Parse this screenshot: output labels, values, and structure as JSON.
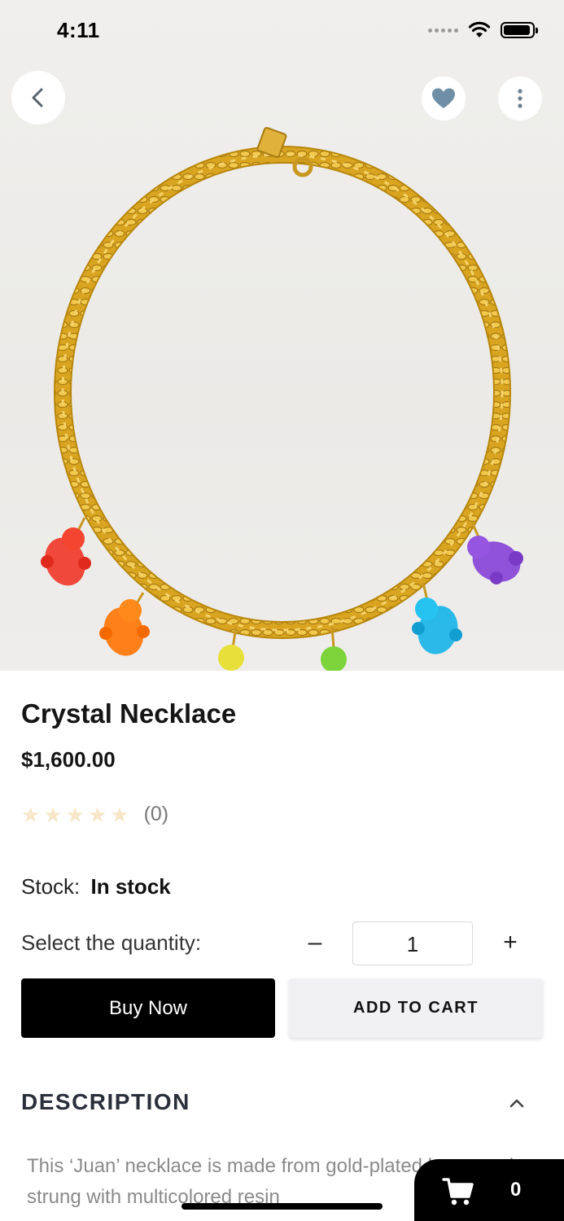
{
  "status_bar": {
    "time": "4:11"
  },
  "nav": {
    "back_icon": "chevron-left-icon",
    "favorite_icon": "heart-icon",
    "more_icon": "more-vertical-icon"
  },
  "product": {
    "title": "Crystal Necklace",
    "price": "$1,600.00",
    "rating_count": "(0)",
    "rating_value": 0,
    "rating_max": 5,
    "stock_label": "Stock:",
    "stock_value": "In stock"
  },
  "quantity": {
    "label": "Select the quantity:",
    "minus": "–",
    "value": "1",
    "plus": "+"
  },
  "actions": {
    "buy_now": "Buy Now",
    "add_to_cart": "ADD TO CART"
  },
  "description": {
    "heading": "DESCRIPTION",
    "text": "This ‘Juan’ necklace is made from gold-plated brass and strung with multicolored resin"
  },
  "cart": {
    "count": "0",
    "icon": "cart-icon"
  },
  "colors": {
    "primary_button": "#000000",
    "secondary_button": "#f1f1f3",
    "star_empty": "#f7e6c8",
    "heading": "#2a2f3a"
  }
}
